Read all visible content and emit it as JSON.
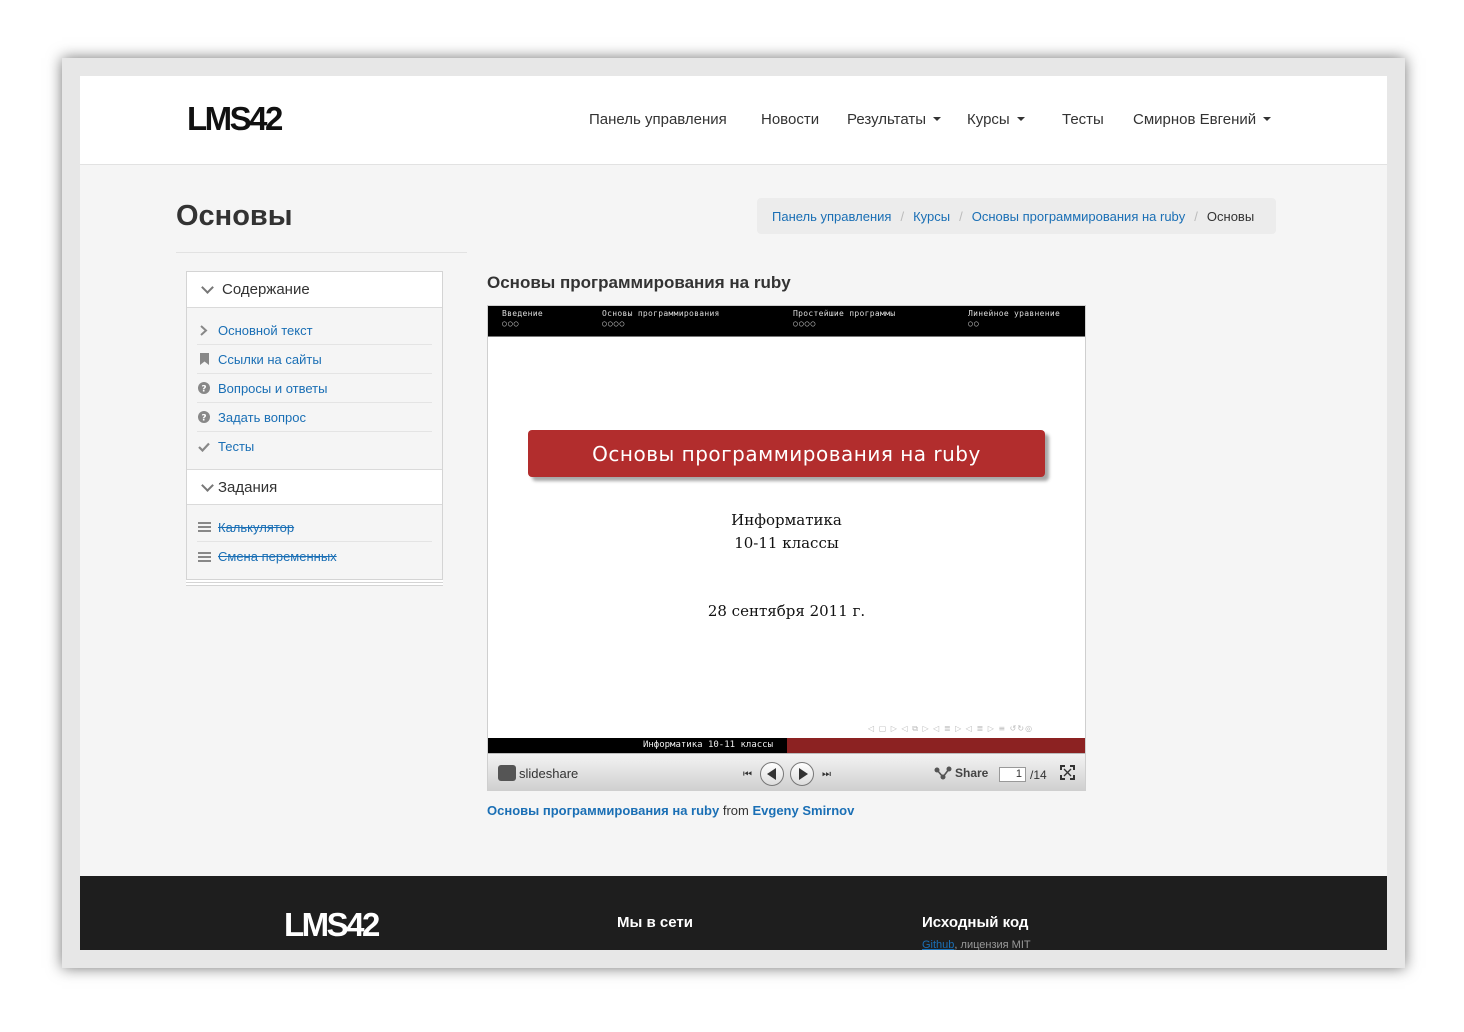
{
  "navbar": {
    "logo": "LMS42",
    "items": [
      {
        "label": "Панель управления"
      },
      {
        "label": "Новости"
      },
      {
        "label": "Результаты"
      },
      {
        "label": "Курсы"
      },
      {
        "label": "Тесты"
      },
      {
        "label": "Смирнов Евгений"
      }
    ]
  },
  "page": {
    "title": "Основы"
  },
  "breadcrumb": {
    "items": [
      "Панель управления",
      "Курсы",
      "Основы программирования на ruby"
    ],
    "active": "Основы",
    "separator": "/"
  },
  "sidebar": {
    "sections": [
      {
        "title": "Содержание",
        "items": [
          {
            "label": "Основной текст",
            "icon": "chevron-right-icon"
          },
          {
            "label": "Ссылки на сайты",
            "icon": "bookmark-icon"
          },
          {
            "label": "Вопросы и ответы",
            "icon": "question-circle-icon"
          },
          {
            "label": "Задать вопрос",
            "icon": "question-circle-icon"
          },
          {
            "label": "Тесты",
            "icon": "check-icon"
          }
        ]
      },
      {
        "title": "Задания",
        "items": [
          {
            "label": "Калькулятор",
            "icon": "tasks-icon",
            "struck": true
          },
          {
            "label": "Смена переменных",
            "icon": "tasks-icon",
            "struck": true
          }
        ]
      }
    ]
  },
  "content": {
    "title": "Основы программирования на ruby"
  },
  "slide": {
    "sections": [
      {
        "name": "Введение",
        "dots": "○○○"
      },
      {
        "name": "Основы программирования",
        "dots": "○○○○"
      },
      {
        "name": "Простейшие программы",
        "dots": "○○○○"
      },
      {
        "name": "Линейное уравнение",
        "dots": "○○"
      }
    ],
    "heading": "Основы программирования на ruby",
    "subject": "Информатика",
    "grade": "10-11 классы",
    "date": "28 сентября 2011 г.",
    "nav_symbols": "◁ ▢ ▷  ◁ ⧉ ▷  ◁ ≣ ▷  ◁ ≣ ▷   ≡   ↺↻◎",
    "footer_text": "Информатика  10-11 классы"
  },
  "player": {
    "brand": "slideshare",
    "share_label": "Share",
    "current_page": "1",
    "total_pages": "/14"
  },
  "credit": {
    "title": "Основы программирования на ruby",
    "from": "from",
    "author": "Evgeny Smirnov"
  },
  "footer": {
    "logo": "LMS42",
    "social_title": "Мы в сети",
    "source_title": "Исходный код",
    "source_link": "Github",
    "source_license": ", лицензия MIT"
  },
  "colors": {
    "link": "#1a6fb5",
    "slide_red": "#b22d2d",
    "footer_bg": "#1e1e1e"
  }
}
